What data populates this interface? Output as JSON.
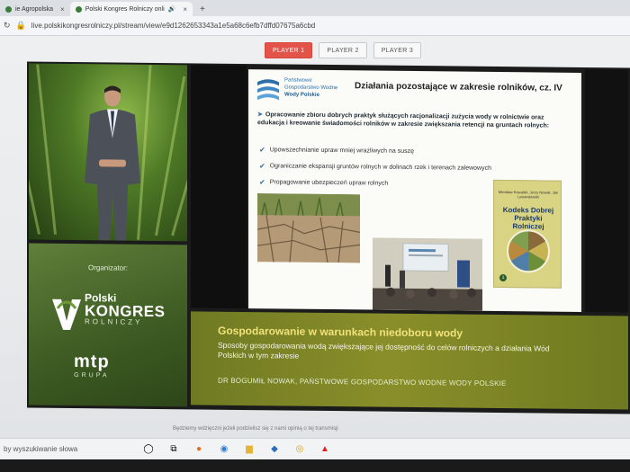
{
  "browser": {
    "tabs": [
      {
        "label": "ie Agropolska",
        "active": false
      },
      {
        "label": "Polski Kongres Rolniczy onli",
        "active": true
      }
    ],
    "new_tab": "+",
    "url": "live.polskikongresrolniczy.pl/stream/view/e9d1262653343a1e5a68c6efb7dffd07675a6cbd"
  },
  "player_tabs": [
    {
      "label": "PLAYER 1",
      "active": true
    },
    {
      "label": "PLAYER 2",
      "active": false
    },
    {
      "label": "PLAYER 3",
      "active": false
    }
  ],
  "organizer": {
    "label": "Organizator:",
    "kongres": {
      "polski": "Polski",
      "kongres": "KONGRES",
      "rolniczy": "ROLNICZY"
    },
    "mtp": {
      "name": "mtp",
      "grupa": "GRUPA"
    }
  },
  "slide": {
    "logo": {
      "line1": "Państwowe",
      "line2": "Gospodarstwo Wodne",
      "line3": "Wody Polskie"
    },
    "title": "Działania pozostające w zakresie rolników, cz. IV",
    "main_point": "Opracowanie zbioru dobrych praktyk służących racjonalizacji zużycia wody w rolnictwie oraz edukacja i kreowanie świadomości rolników w zakresie zwiększania retencji na gruntach rolnych:",
    "bullets": [
      "Upowszechnianie upraw mniej wrażliwych na suszę",
      "Ograniczanie ekspansji gruntów rolnych w dolinach rzek i terenach zalewowych",
      "Propagowanie ubezpieczeń upraw rolnych"
    ],
    "book": {
      "authors": "Mirosław Kowalski, Jerzy Nowak, Jan Lewandowski",
      "title": "Kodeks Dobrej Praktyki Rolniczej",
      "number": "1"
    }
  },
  "banner": {
    "title": "Gospodarowanie w warunkach niedoboru wody",
    "subtitle": "Sposoby gospodarowania wodą zwiększające jej dostępność do celów rolniczych a działania Wód Polskich w tym zakresie",
    "speaker": "DR BOGUMIŁ NOWAK, PAŃSTWOWE GOSPODARSTWO WODNE WODY POLSKIE"
  },
  "below_text": "Będziemy wdzięczni jeżeli podzielisz się z nami opinią o tej transmisji",
  "taskbar": {
    "search_placeholder": "by wyszukiwanie słowa"
  },
  "colors": {
    "accent": "#e2534a",
    "banner": "#7a8426",
    "banner_title": "#f1e27a"
  }
}
